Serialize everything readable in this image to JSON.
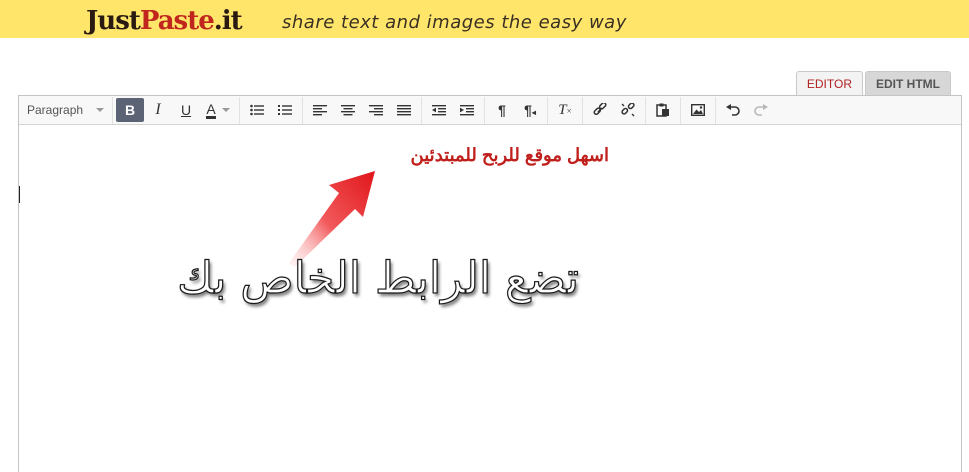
{
  "header": {
    "logo_just": "Just",
    "logo_paste": "Paste",
    "logo_tld": ".it",
    "tagline": "share text and images the easy way"
  },
  "tabs": [
    {
      "label": "EDITOR",
      "active": true
    },
    {
      "label": "EDIT HTML",
      "active": false
    }
  ],
  "toolbar": {
    "format_select": "Paragraph",
    "bold": "B",
    "italic": "I",
    "underline": "U",
    "text_color": "A",
    "icons": [
      "bullet-list-icon",
      "numbered-list-icon",
      "align-left-icon",
      "align-center-icon",
      "align-right-icon",
      "align-justify-icon",
      "outdent-icon",
      "indent-icon",
      "ltr-icon",
      "rtl-icon",
      "clear-format-icon",
      "link-icon",
      "unlink-icon",
      "paste-icon",
      "image-icon",
      "undo-icon",
      "redo-icon"
    ]
  },
  "content": {
    "headline": "اسهل موقع للربح للمبتدئين",
    "callout": "تضع الرابط الخاص بك"
  },
  "colors": {
    "header_bg": "#ffe66b",
    "headline_red": "#c0201c",
    "active_tab_text": "#b22222",
    "arrow_red": "#e8191c"
  }
}
